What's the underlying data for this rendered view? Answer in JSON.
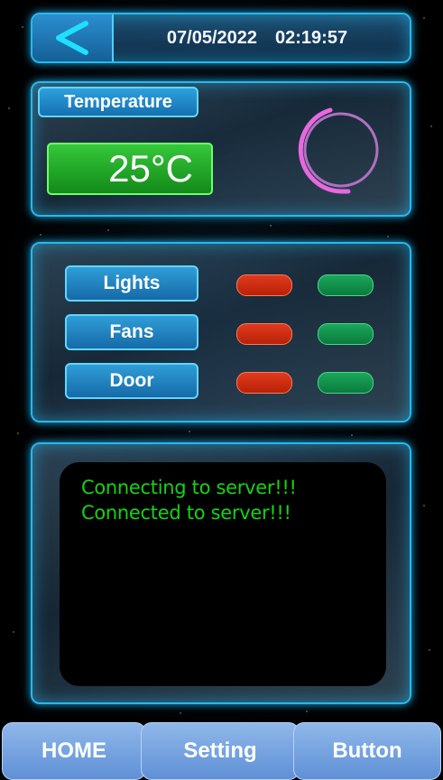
{
  "header": {
    "back_icon": "chevron-left-icon",
    "date": "07/05/2022",
    "time": "02:19:57"
  },
  "temperature": {
    "title": "Temperature",
    "value": "25°C",
    "gauge_colors": [
      "#e060d8",
      "#a060b8"
    ]
  },
  "devices": [
    {
      "label": "Lights"
    },
    {
      "label": "Fans"
    },
    {
      "label": "Door"
    }
  ],
  "log": {
    "lines": [
      "Connecting to server!!!",
      "Connected to server!!!"
    ]
  },
  "nav": {
    "home": "HOME",
    "setting": "Setting",
    "button": "Button"
  },
  "colors": {
    "accent": "#27b8ee",
    "off": "#d02a10",
    "on": "#119050",
    "log_text": "#14d414"
  }
}
